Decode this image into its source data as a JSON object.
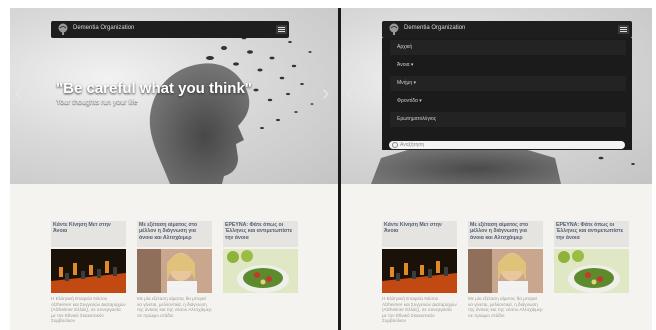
{
  "site": {
    "brand": "Dementia Organization",
    "hero_title": "\"Be careful what you think\"",
    "hero_subtitle": "Your thoughts run your life",
    "prev_arrow": "‹",
    "next_arrow": "›"
  },
  "menu": {
    "items": [
      {
        "label": "Αρχική"
      },
      {
        "label": "Άνοια ▾"
      },
      {
        "label": "Μνήμη ▾"
      },
      {
        "label": "Φροντίδα ▾"
      },
      {
        "label": "Ερωτηματολόγιος"
      }
    ],
    "search_placeholder": "Αναζήτηση"
  },
  "articles": [
    {
      "title": "Κάντε Κίνηση Μετ στην Άνοια",
      "excerpt": "Η Ελληνική Εταιρεία Νόσου Alzheimer και Συγγενών Διαταραχών (Alzheimer Ελλάς), σε συνεργασία με τον Εθνικό Σκακιστικόν Συμβούλιον"
    },
    {
      "title": "Με εξέταση αίματος στο μέλλον η διάγνωση για άνοια και Αλτσχάιμερ",
      "excerpt": "Με μία εξέταση αίματος θα μπορεί να γίνεται, μελλοντικά, η διάγνωση της άνοιας και της νόσου Αλτσχάιμερ σε πρώιμο στάδιο"
    },
    {
      "title": "ΕΡΕΥΝΑ: Φάτε όπως οι Έλληνες και αντιμετωπίστε την άνοια",
      "excerpt": ""
    }
  ],
  "colors": {
    "navbar": "#1e1e1e",
    "card_title": "#4f5d74",
    "background": "#f4f3ef"
  }
}
